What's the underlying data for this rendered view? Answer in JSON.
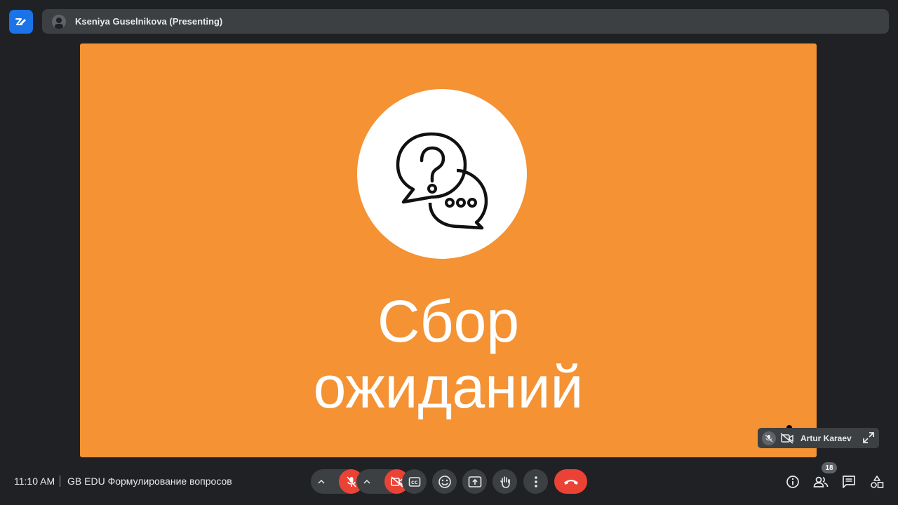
{
  "header": {
    "presenter": "Kseniya Guselnikova (Presenting)"
  },
  "slide": {
    "title_line1": "Сбор",
    "title_line2": "ожиданий",
    "icon": "question-and-chat-bubbles-icon"
  },
  "participant_tile": {
    "name": "Artur Karaev",
    "icons": [
      "mic-off-icon",
      "camera-off-icon",
      "expand-icon"
    ]
  },
  "footer": {
    "time": "11:10 AM",
    "meeting_name": "GB EDU Формулирование вопросов",
    "participant_count": "18"
  },
  "controls": [
    "mic-options",
    "mic-off",
    "camera-options",
    "camera-off",
    "captions",
    "reactions",
    "present",
    "raise-hand",
    "more-options",
    "leave-call"
  ],
  "side_controls": [
    "meeting-details",
    "people",
    "chat",
    "activities"
  ],
  "colors": {
    "background": "#202124",
    "slide": "#f49234",
    "button": "#3c4043",
    "danger": "#ea4335",
    "app_icon": "#1a73e8"
  }
}
